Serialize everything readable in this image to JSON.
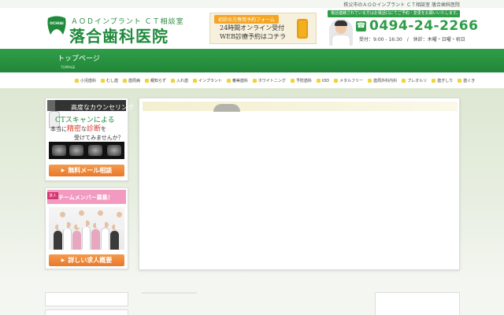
{
  "tagline": "秩父市のＡＯＤインプラント ＣＴ相談室 落合歯科医院",
  "logo": {
    "mark_text": "OCHIAI",
    "sub": "ＡＯＤインプラント ＣＴ相談室",
    "name": "落合歯科医院",
    "color": "#1f8a3c"
  },
  "banner": {
    "badge": "初診の方専用予約フォーム",
    "line1": "24時間オンライン受付",
    "line2": "WEB診療予約はコチラ",
    "icon": "smartphone-icon"
  },
  "contact": {
    "notice": "電話連絡されている方はお電話口にてご予約・変更をお願いいたします。",
    "tel_icon": "phone-icon",
    "phone": "0494-24-2266",
    "hours": "受付：9:00 - 16:30　/　休診：木曜・日曜・祝日"
  },
  "nav": {
    "items": [
      {
        "label": "トップページ",
        "sub": "TOPPAGE"
      }
    ]
  },
  "categories": [
    "小児歯科",
    "むし歯",
    "歯周病",
    "親知らず",
    "入れ歯",
    "インプラント",
    "審美歯科",
    "ホワイトニング",
    "予防歯科",
    "IOD",
    "メタルフリー",
    "歯周外科内科",
    "プレオルソ",
    "歯ぎしり",
    "歯ぐき"
  ],
  "sidebar": {
    "counseling": {
      "heading": "高度なカウンセリング",
      "ct_line": "CTスキャンによる",
      "line2_pre": "本当に",
      "line2_hl1": "精密",
      "line2_mid": "な",
      "line2_hl2": "診断",
      "line2_post": "を",
      "line3": "受けてみませんか？",
      "button": "無料メール相談"
    },
    "recruit": {
      "tag": "求人",
      "heading": "チームメンバー募集！",
      "button": "詳しい求人概要"
    }
  },
  "colors": {
    "brand_green": "#2f9d47",
    "accent_orange": "#e9782a",
    "recruit_pink": "#f39ac0"
  }
}
